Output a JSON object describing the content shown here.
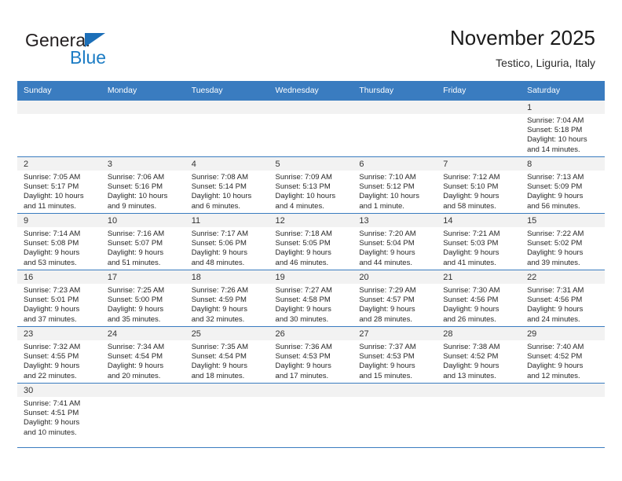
{
  "logo": {
    "word1": "General",
    "word2": "Blue",
    "triangle_color": "#1c6fb8",
    "blue_color": "#1c7cc4"
  },
  "header": {
    "title": "November 2025",
    "subtitle": "Testico, Liguria, Italy"
  },
  "colors": {
    "header_bg": "#3a7cc0",
    "header_text": "#ffffff",
    "daynum_band": "#f2f2f2",
    "grid_line": "#3a7cc0"
  },
  "weekday_headers": [
    "Sunday",
    "Monday",
    "Tuesday",
    "Wednesday",
    "Thursday",
    "Friday",
    "Saturday"
  ],
  "labels": {
    "sunrise": "Sunrise:",
    "sunset": "Sunset:",
    "daylight": "Daylight:"
  },
  "weeks": [
    [
      {
        "empty": true
      },
      {
        "empty": true
      },
      {
        "empty": true
      },
      {
        "empty": true
      },
      {
        "empty": true
      },
      {
        "empty": true
      },
      {
        "empty": false,
        "day": "1",
        "sunrise": "Sunrise: 7:04 AM",
        "sunset": "Sunset: 5:18 PM",
        "daylight_line1": "Daylight: 10 hours",
        "daylight_line2": "and 14 minutes."
      }
    ],
    [
      {
        "empty": false,
        "day": "2",
        "sunrise": "Sunrise: 7:05 AM",
        "sunset": "Sunset: 5:17 PM",
        "daylight_line1": "Daylight: 10 hours",
        "daylight_line2": "and 11 minutes."
      },
      {
        "empty": false,
        "day": "3",
        "sunrise": "Sunrise: 7:06 AM",
        "sunset": "Sunset: 5:16 PM",
        "daylight_line1": "Daylight: 10 hours",
        "daylight_line2": "and 9 minutes."
      },
      {
        "empty": false,
        "day": "4",
        "sunrise": "Sunrise: 7:08 AM",
        "sunset": "Sunset: 5:14 PM",
        "daylight_line1": "Daylight: 10 hours",
        "daylight_line2": "and 6 minutes."
      },
      {
        "empty": false,
        "day": "5",
        "sunrise": "Sunrise: 7:09 AM",
        "sunset": "Sunset: 5:13 PM",
        "daylight_line1": "Daylight: 10 hours",
        "daylight_line2": "and 4 minutes."
      },
      {
        "empty": false,
        "day": "6",
        "sunrise": "Sunrise: 7:10 AM",
        "sunset": "Sunset: 5:12 PM",
        "daylight_line1": "Daylight: 10 hours",
        "daylight_line2": "and 1 minute."
      },
      {
        "empty": false,
        "day": "7",
        "sunrise": "Sunrise: 7:12 AM",
        "sunset": "Sunset: 5:10 PM",
        "daylight_line1": "Daylight: 9 hours",
        "daylight_line2": "and 58 minutes."
      },
      {
        "empty": false,
        "day": "8",
        "sunrise": "Sunrise: 7:13 AM",
        "sunset": "Sunset: 5:09 PM",
        "daylight_line1": "Daylight: 9 hours",
        "daylight_line2": "and 56 minutes."
      }
    ],
    [
      {
        "empty": false,
        "day": "9",
        "sunrise": "Sunrise: 7:14 AM",
        "sunset": "Sunset: 5:08 PM",
        "daylight_line1": "Daylight: 9 hours",
        "daylight_line2": "and 53 minutes."
      },
      {
        "empty": false,
        "day": "10",
        "sunrise": "Sunrise: 7:16 AM",
        "sunset": "Sunset: 5:07 PM",
        "daylight_line1": "Daylight: 9 hours",
        "daylight_line2": "and 51 minutes."
      },
      {
        "empty": false,
        "day": "11",
        "sunrise": "Sunrise: 7:17 AM",
        "sunset": "Sunset: 5:06 PM",
        "daylight_line1": "Daylight: 9 hours",
        "daylight_line2": "and 48 minutes."
      },
      {
        "empty": false,
        "day": "12",
        "sunrise": "Sunrise: 7:18 AM",
        "sunset": "Sunset: 5:05 PM",
        "daylight_line1": "Daylight: 9 hours",
        "daylight_line2": "and 46 minutes."
      },
      {
        "empty": false,
        "day": "13",
        "sunrise": "Sunrise: 7:20 AM",
        "sunset": "Sunset: 5:04 PM",
        "daylight_line1": "Daylight: 9 hours",
        "daylight_line2": "and 44 minutes."
      },
      {
        "empty": false,
        "day": "14",
        "sunrise": "Sunrise: 7:21 AM",
        "sunset": "Sunset: 5:03 PM",
        "daylight_line1": "Daylight: 9 hours",
        "daylight_line2": "and 41 minutes."
      },
      {
        "empty": false,
        "day": "15",
        "sunrise": "Sunrise: 7:22 AM",
        "sunset": "Sunset: 5:02 PM",
        "daylight_line1": "Daylight: 9 hours",
        "daylight_line2": "and 39 minutes."
      }
    ],
    [
      {
        "empty": false,
        "day": "16",
        "sunrise": "Sunrise: 7:23 AM",
        "sunset": "Sunset: 5:01 PM",
        "daylight_line1": "Daylight: 9 hours",
        "daylight_line2": "and 37 minutes."
      },
      {
        "empty": false,
        "day": "17",
        "sunrise": "Sunrise: 7:25 AM",
        "sunset": "Sunset: 5:00 PM",
        "daylight_line1": "Daylight: 9 hours",
        "daylight_line2": "and 35 minutes."
      },
      {
        "empty": false,
        "day": "18",
        "sunrise": "Sunrise: 7:26 AM",
        "sunset": "Sunset: 4:59 PM",
        "daylight_line1": "Daylight: 9 hours",
        "daylight_line2": "and 32 minutes."
      },
      {
        "empty": false,
        "day": "19",
        "sunrise": "Sunrise: 7:27 AM",
        "sunset": "Sunset: 4:58 PM",
        "daylight_line1": "Daylight: 9 hours",
        "daylight_line2": "and 30 minutes."
      },
      {
        "empty": false,
        "day": "20",
        "sunrise": "Sunrise: 7:29 AM",
        "sunset": "Sunset: 4:57 PM",
        "daylight_line1": "Daylight: 9 hours",
        "daylight_line2": "and 28 minutes."
      },
      {
        "empty": false,
        "day": "21",
        "sunrise": "Sunrise: 7:30 AM",
        "sunset": "Sunset: 4:56 PM",
        "daylight_line1": "Daylight: 9 hours",
        "daylight_line2": "and 26 minutes."
      },
      {
        "empty": false,
        "day": "22",
        "sunrise": "Sunrise: 7:31 AM",
        "sunset": "Sunset: 4:56 PM",
        "daylight_line1": "Daylight: 9 hours",
        "daylight_line2": "and 24 minutes."
      }
    ],
    [
      {
        "empty": false,
        "day": "23",
        "sunrise": "Sunrise: 7:32 AM",
        "sunset": "Sunset: 4:55 PM",
        "daylight_line1": "Daylight: 9 hours",
        "daylight_line2": "and 22 minutes."
      },
      {
        "empty": false,
        "day": "24",
        "sunrise": "Sunrise: 7:34 AM",
        "sunset": "Sunset: 4:54 PM",
        "daylight_line1": "Daylight: 9 hours",
        "daylight_line2": "and 20 minutes."
      },
      {
        "empty": false,
        "day": "25",
        "sunrise": "Sunrise: 7:35 AM",
        "sunset": "Sunset: 4:54 PM",
        "daylight_line1": "Daylight: 9 hours",
        "daylight_line2": "and 18 minutes."
      },
      {
        "empty": false,
        "day": "26",
        "sunrise": "Sunrise: 7:36 AM",
        "sunset": "Sunset: 4:53 PM",
        "daylight_line1": "Daylight: 9 hours",
        "daylight_line2": "and 17 minutes."
      },
      {
        "empty": false,
        "day": "27",
        "sunrise": "Sunrise: 7:37 AM",
        "sunset": "Sunset: 4:53 PM",
        "daylight_line1": "Daylight: 9 hours",
        "daylight_line2": "and 15 minutes."
      },
      {
        "empty": false,
        "day": "28",
        "sunrise": "Sunrise: 7:38 AM",
        "sunset": "Sunset: 4:52 PM",
        "daylight_line1": "Daylight: 9 hours",
        "daylight_line2": "and 13 minutes."
      },
      {
        "empty": false,
        "day": "29",
        "sunrise": "Sunrise: 7:40 AM",
        "sunset": "Sunset: 4:52 PM",
        "daylight_line1": "Daylight: 9 hours",
        "daylight_line2": "and 12 minutes."
      }
    ],
    [
      {
        "empty": false,
        "day": "30",
        "sunrise": "Sunrise: 7:41 AM",
        "sunset": "Sunset: 4:51 PM",
        "daylight_line1": "Daylight: 9 hours",
        "daylight_line2": "and 10 minutes."
      },
      {
        "empty": true
      },
      {
        "empty": true
      },
      {
        "empty": true
      },
      {
        "empty": true
      },
      {
        "empty": true
      },
      {
        "empty": true
      }
    ]
  ]
}
